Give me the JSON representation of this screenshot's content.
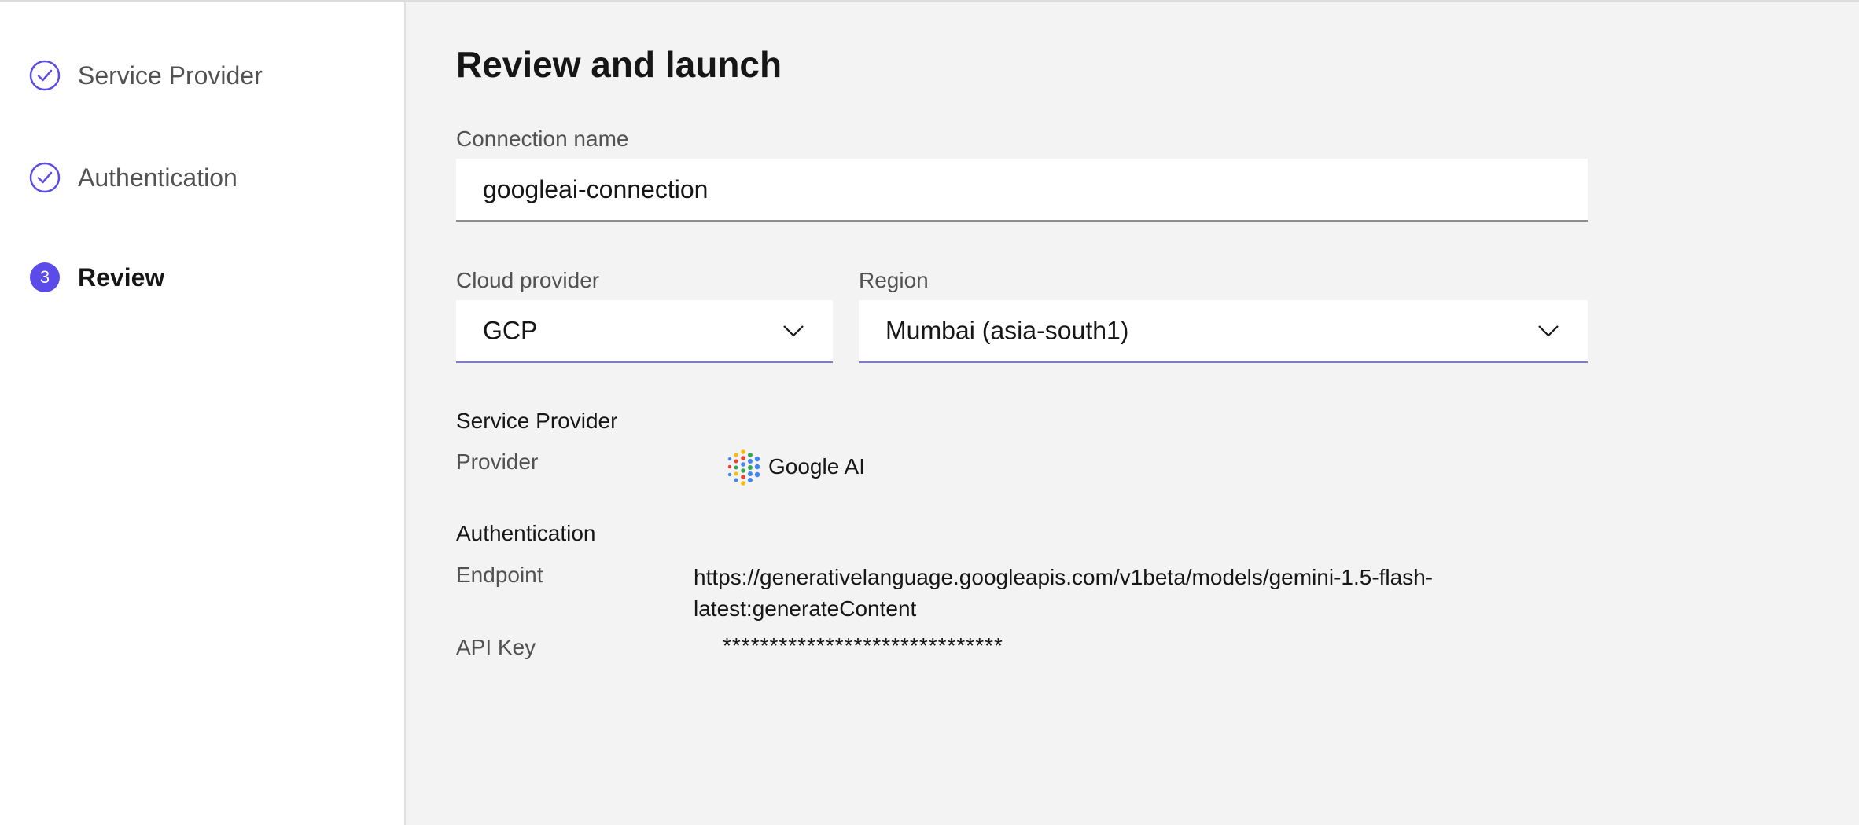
{
  "steps": [
    {
      "label": "Service Provider",
      "state": "complete",
      "icon": "check-circle-icon"
    },
    {
      "label": "Authentication",
      "state": "complete",
      "icon": "check-circle-icon"
    },
    {
      "label": "Review",
      "state": "current",
      "number": "3"
    }
  ],
  "page": {
    "title": "Review and launch"
  },
  "form": {
    "connection_name": {
      "label": "Connection name",
      "value": "googleai-connection"
    },
    "cloud_provider": {
      "label": "Cloud provider",
      "value": "GCP"
    },
    "region": {
      "label": "Region",
      "value": "Mumbai (asia-south1)"
    }
  },
  "summary": {
    "service_provider": {
      "heading": "Service Provider",
      "provider_label": "Provider",
      "provider_value": "Google AI",
      "provider_icon": "google-ai-logo-icon"
    },
    "authentication": {
      "heading": "Authentication",
      "endpoint_label": "Endpoint",
      "endpoint_value_line1": "https://generativelanguage.googleapis.com/v1beta/models/gemini-1.5-flash-",
      "endpoint_value_line2": "latest:generateContent",
      "api_key_label": "API Key",
      "api_key_value": "******************************"
    }
  },
  "colors": {
    "accent": "#5b4be8",
    "background": "#f3f3f3"
  }
}
